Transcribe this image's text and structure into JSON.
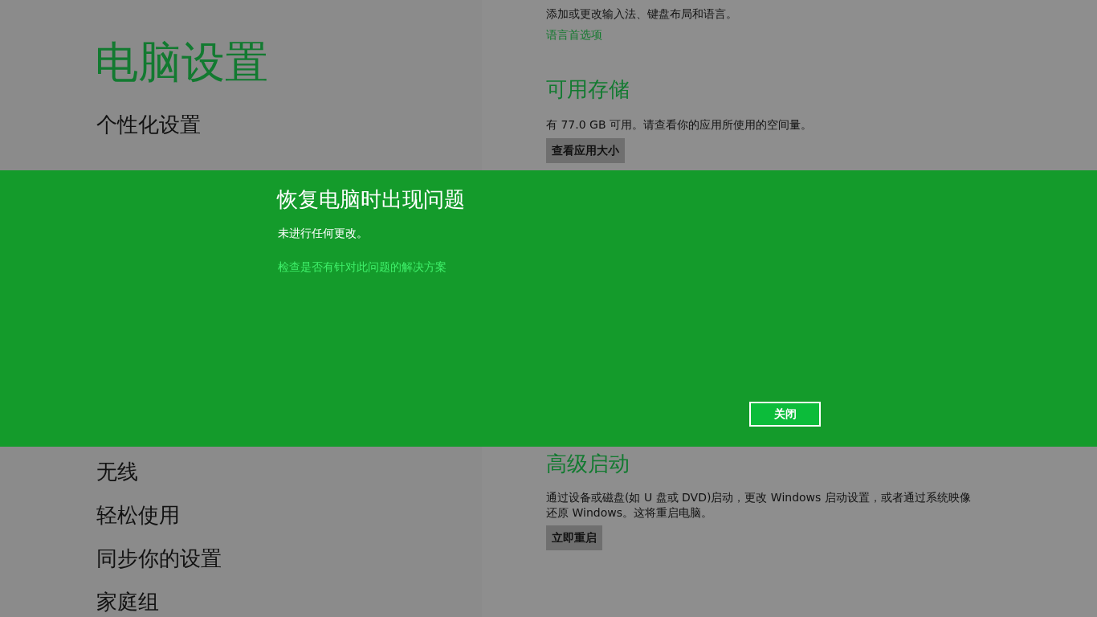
{
  "sidebar": {
    "title": "电脑设置",
    "items_top": [
      {
        "label": "个性化设置"
      }
    ],
    "items_bottom": [
      {
        "label": "无线"
      },
      {
        "label": "轻松使用"
      },
      {
        "label": "同步你的设置"
      },
      {
        "label": "家庭组"
      }
    ]
  },
  "content": {
    "sections_top": [
      {
        "description": "添加或更改输入法、键盘布局和语言。",
        "link": "语言首选项"
      },
      {
        "heading": "可用存储",
        "description": "有 77.0 GB 可用。请查看你的应用所使用的空间量。",
        "button": "查看应用大小"
      }
    ],
    "sections_bottom": [
      {
        "heading": "高级启动",
        "description": "通过设备或磁盘(如 U 盘或 DVD)启动，更改 Windows 启动设置，或者通过系统映像还原 Windows。这将重启电脑。",
        "button": "立即重启"
      }
    ]
  },
  "dialog": {
    "title": "恢复电脑时出现问题",
    "message": "未进行任何更改。",
    "link": "检查是否有针对此问题的解决方案",
    "button": "关闭"
  }
}
